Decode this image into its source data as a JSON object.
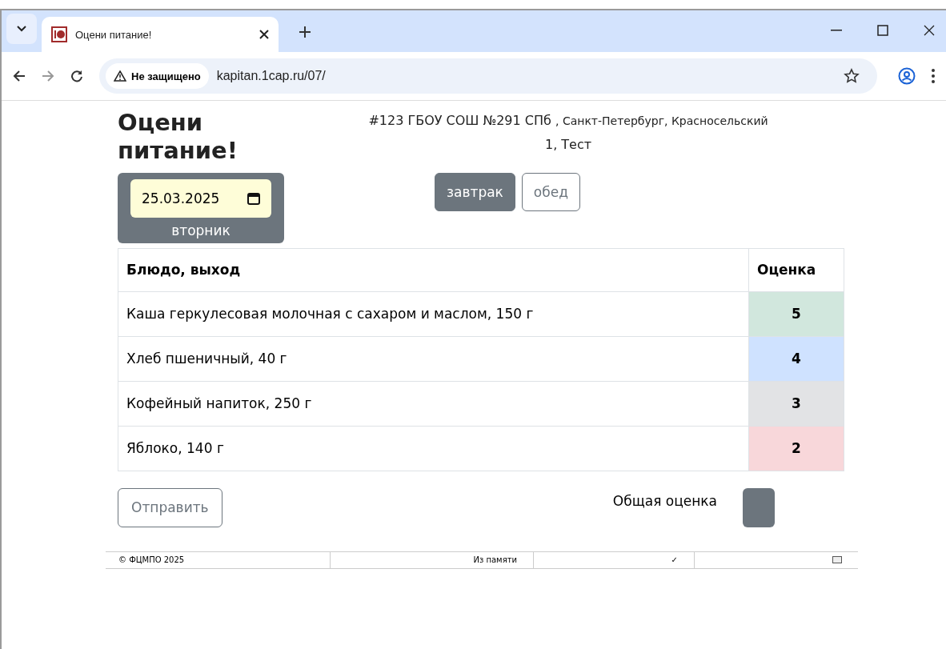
{
  "browser": {
    "tab_title": "Оцени питание!",
    "security": "Не защищено",
    "url": "kapitan.1cap.ru/07/"
  },
  "page": {
    "title": "Оцени питание!",
    "school": "#123 ГБОУ СОШ №291 СПб",
    "address": ", Санкт-Петербург, Красносельский",
    "address_tail": "1, Тест",
    "date": "25.03.2025",
    "weekday": "вторник",
    "meals": [
      {
        "label": "завтрак",
        "selected": true
      },
      {
        "label": "обед",
        "selected": false
      }
    ],
    "table": {
      "columns": [
        "Блюдо, выход",
        "Оценка"
      ],
      "rows": [
        {
          "dish": "Каша геркулесовая молочная с сахаром и маслом, 150 г",
          "rating": "5",
          "color": "#d1e7dd"
        },
        {
          "dish": "Хлеб пшеничный, 40 г",
          "rating": "4",
          "color": "#cfe2ff"
        },
        {
          "dish": "Кофейный напиток, 250 г",
          "rating": "3",
          "color": "#e2e3e5"
        },
        {
          "dish": "Яблоко, 140 г",
          "rating": "2",
          "color": "#f8d7da"
        }
      ]
    },
    "submit": "Отправить",
    "overall_label": "Общая оценка"
  },
  "status_bar": {
    "copyright": "© ФЦМПО 2025",
    "source": "Из памяти",
    "check": "✓"
  }
}
